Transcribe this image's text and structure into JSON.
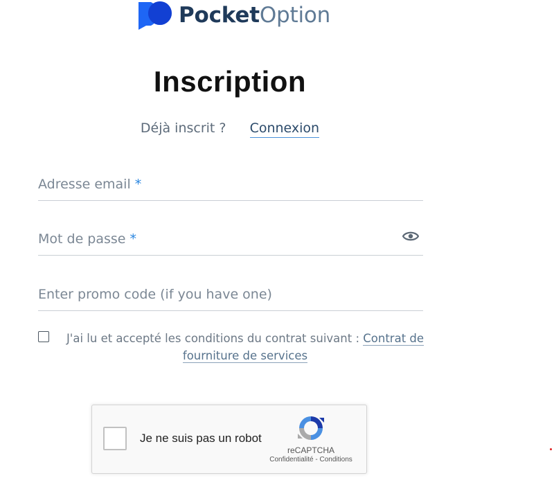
{
  "brand": {
    "name_bold": "Pocket",
    "name_light": "Option",
    "icon": "pocket-option-logo-icon",
    "colors": {
      "dark": "#1f3a5a",
      "blue": "#1e66f5",
      "navy": "#0b2fc4"
    }
  },
  "title": "Inscription",
  "login_prompt": {
    "question": "Déjà inscrit ?",
    "link_label": "Connexion"
  },
  "form": {
    "email": {
      "label": "Adresse email",
      "required_mark": "*",
      "value": ""
    },
    "password": {
      "label": "Mot de passe",
      "required_mark": "*",
      "value": "",
      "toggle_icon": "eye-icon"
    },
    "promo": {
      "label": "Enter promo code (if you have one)",
      "value": ""
    }
  },
  "terms": {
    "checked": false,
    "text": "J'ai lu et accepté les conditions du contrat suivant : ",
    "link_label": "Contrat de fourniture de services"
  },
  "captcha": {
    "label": "Je ne suis pas un robot",
    "brand": "reCAPTCHA",
    "privacy_label": "Confidentialité",
    "separator": " - ",
    "terms_label": "Conditions",
    "checked": false,
    "icon": "recaptcha-icon"
  },
  "accent_color": "#2a86e0"
}
